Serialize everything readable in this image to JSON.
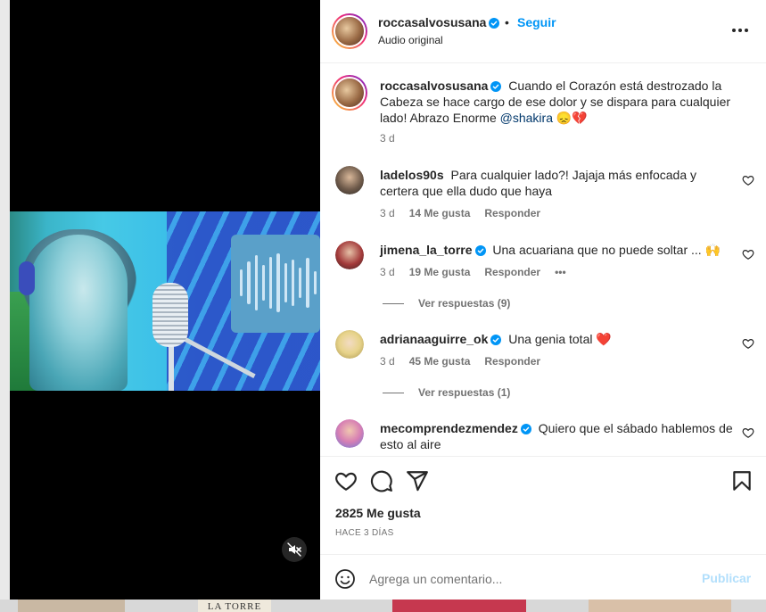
{
  "colors": {
    "accent": "#0095f6",
    "text": "#262626",
    "muted": "#737373",
    "publish_disabled": "#b2dffc",
    "heart_red": "#ed4956"
  },
  "background": {
    "thumb_text": "LA TORRE"
  },
  "header": {
    "username": "roccasalvosusana",
    "separator": "•",
    "follow_label": "Seguir",
    "audio_label": "Audio original",
    "more_icon": "more-horizontal-icon"
  },
  "caption": {
    "username": "roccasalvosusana",
    "text": "Cuando el Corazón está destrozado la Cabeza se hace cargo de ese dolor y se dispara para cualquier lado! Abrazo Enorme",
    "mention": "@shakira",
    "emojis": "😞💔",
    "time": "3 d"
  },
  "comments": [
    {
      "username": "ladelos90s",
      "verified": false,
      "text": "Para cualquier lado?! Jajaja más enfocada y certera que ella dudo que haya",
      "time": "3 d",
      "likes": "14 Me gusta",
      "reply_label": "Responder"
    },
    {
      "username": "jimena_la_torre",
      "verified": true,
      "text": "Una acuariana que no puede soltar ...",
      "emoji": "🙌",
      "time": "3 d",
      "likes": "19 Me gusta",
      "reply_label": "Responder",
      "more": "•••",
      "view_replies": "Ver respuestas (9)"
    },
    {
      "username": "adrianaaguirre_ok",
      "verified": true,
      "text": "Una genia total",
      "emoji": "❤️",
      "time": "3 d",
      "likes": "45 Me gusta",
      "reply_label": "Responder",
      "view_replies": "Ver respuestas (1)"
    },
    {
      "username": "mecomprendezmendez",
      "verified": true,
      "text": "Quiero que el sábado hablemos de esto al aire"
    }
  ],
  "actions": {
    "like_icon": "heart-icon",
    "comment_icon": "comment-icon",
    "share_icon": "send-icon",
    "save_icon": "bookmark-icon",
    "likes_count": "2825 Me gusta",
    "time_ago": "HACE 3 DÍAS"
  },
  "composer": {
    "placeholder": "Agrega un comentario...",
    "publish_label": "Publicar",
    "emoji_icon": "smiley-icon"
  },
  "media": {
    "mute_icon": "muted-speaker-icon"
  }
}
